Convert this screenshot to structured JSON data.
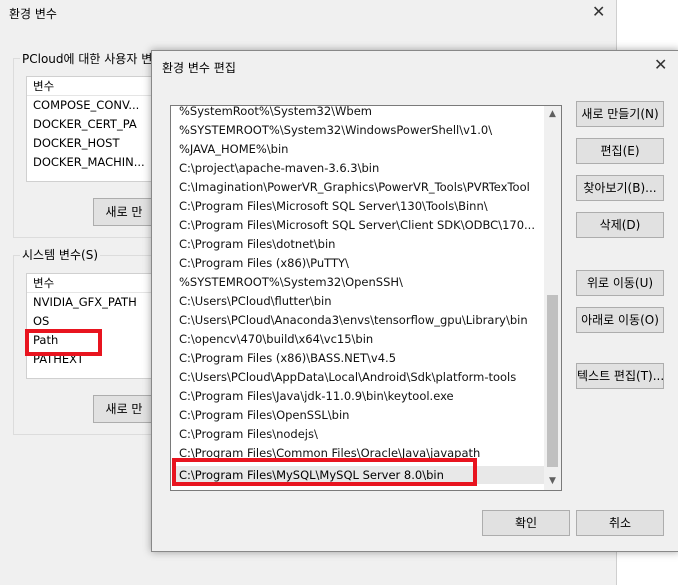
{
  "background_window": {
    "title": "환경 변수",
    "user_group_label": "PCloud에 대한 사용자 변",
    "user_list": {
      "header": "변수",
      "rows": [
        "COMPOSE_CONV...",
        "DOCKER_CERT_PA",
        "DOCKER_HOST",
        "DOCKER_MACHIN..."
      ]
    },
    "user_new_button": "새로 만",
    "system_group_label": "시스템 변수(S)",
    "system_list": {
      "header": "변수",
      "rows": [
        "NVIDIA_GFX_PATH",
        "OS",
        "Path",
        "PATHEXT"
      ]
    },
    "system_new_button": "새로 만"
  },
  "dialog": {
    "title": "환경 변수 편집",
    "paths": [
      "%SystemRoot%\\System32\\Wbem",
      "%SYSTEMROOT%\\System32\\WindowsPowerShell\\v1.0\\",
      "%JAVA_HOME%\\bin",
      "C:\\project\\apache-maven-3.6.3\\bin",
      "C:\\Imagination\\PowerVR_Graphics\\PowerVR_Tools\\PVRTexTool",
      "C:\\Program Files\\Microsoft SQL Server\\130\\Tools\\Binn\\",
      "C:\\Program Files\\Microsoft SQL Server\\Client SDK\\ODBC\\170...",
      "C:\\Program Files\\dotnet\\bin",
      "C:\\Program Files (x86)\\PuTTY\\",
      "%SYSTEMROOT%\\System32\\OpenSSH\\",
      "C:\\Users\\PCloud\\flutter\\bin",
      "C:\\Users\\PCloud\\Anaconda3\\envs\\tensorflow_gpu\\Library\\bin",
      "C:\\opencv\\470\\build\\x64\\vc15\\bin",
      "C:\\Program Files (x86)\\BASS.NET\\v4.5",
      "C:\\Users\\PCloud\\AppData\\Local\\Android\\Sdk\\platform-tools",
      "C:\\Program Files\\Java\\jdk-11.0.9\\bin\\keytool.exe",
      "C:\\Program Files\\OpenSSL\\bin",
      "C:\\Program Files\\nodejs\\",
      "C:\\Program Files\\Common Files\\Oracle\\Java\\javapath",
      "C:\\Program Files\\MySQL\\MySQL Server 8.0\\bin"
    ],
    "buttons": {
      "new": "새로 만들기(N)",
      "edit": "편집(E)",
      "browse": "찾아보기(B)...",
      "delete": "삭제(D)",
      "move_up": "위로 이동(U)",
      "move_down": "아래로 이동(O)",
      "edit_text": "텍스트 편집(T)...",
      "ok": "확인",
      "cancel": "취소"
    }
  },
  "colors": {
    "highlight_red": "#e8141f",
    "window_bg": "#f0f0f0"
  }
}
